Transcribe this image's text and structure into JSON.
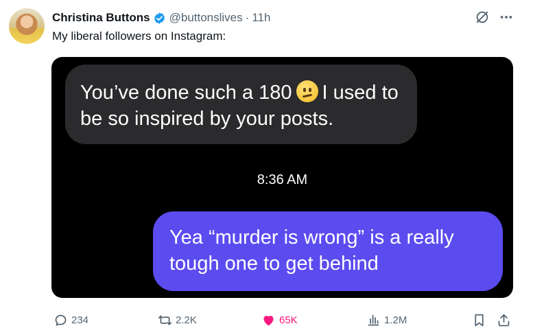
{
  "tweet": {
    "author_name": "Christina Buttons",
    "handle": "@buttonslives",
    "separator": "·",
    "time": "11h",
    "text": "My liberal followers on Instagram:"
  },
  "media": {
    "incoming_message": "You’ve done such a 180 🙁 I used to be so inspired by your posts.",
    "incoming_part1": "You’ve done such a 180",
    "incoming_part2": "I used to be so inspired by your posts.",
    "timestamp": "8:36 AM",
    "outgoing_message": "Yea “murder is wrong” is a really tough one to get behind"
  },
  "actions": {
    "replies": "234",
    "reposts": "2.2K",
    "likes": "65K",
    "views": "1.2M"
  },
  "colors": {
    "verified": "#1d9bf0",
    "like": "#f91880",
    "outgoing_bubble": "#5b4cf0",
    "incoming_bubble": "#2b2b2e"
  },
  "icons": [
    "verified-badge-icon",
    "grok-icon",
    "more-icon",
    "reply-icon",
    "repost-icon",
    "like-icon",
    "views-icon",
    "bookmark-icon",
    "share-icon"
  ]
}
